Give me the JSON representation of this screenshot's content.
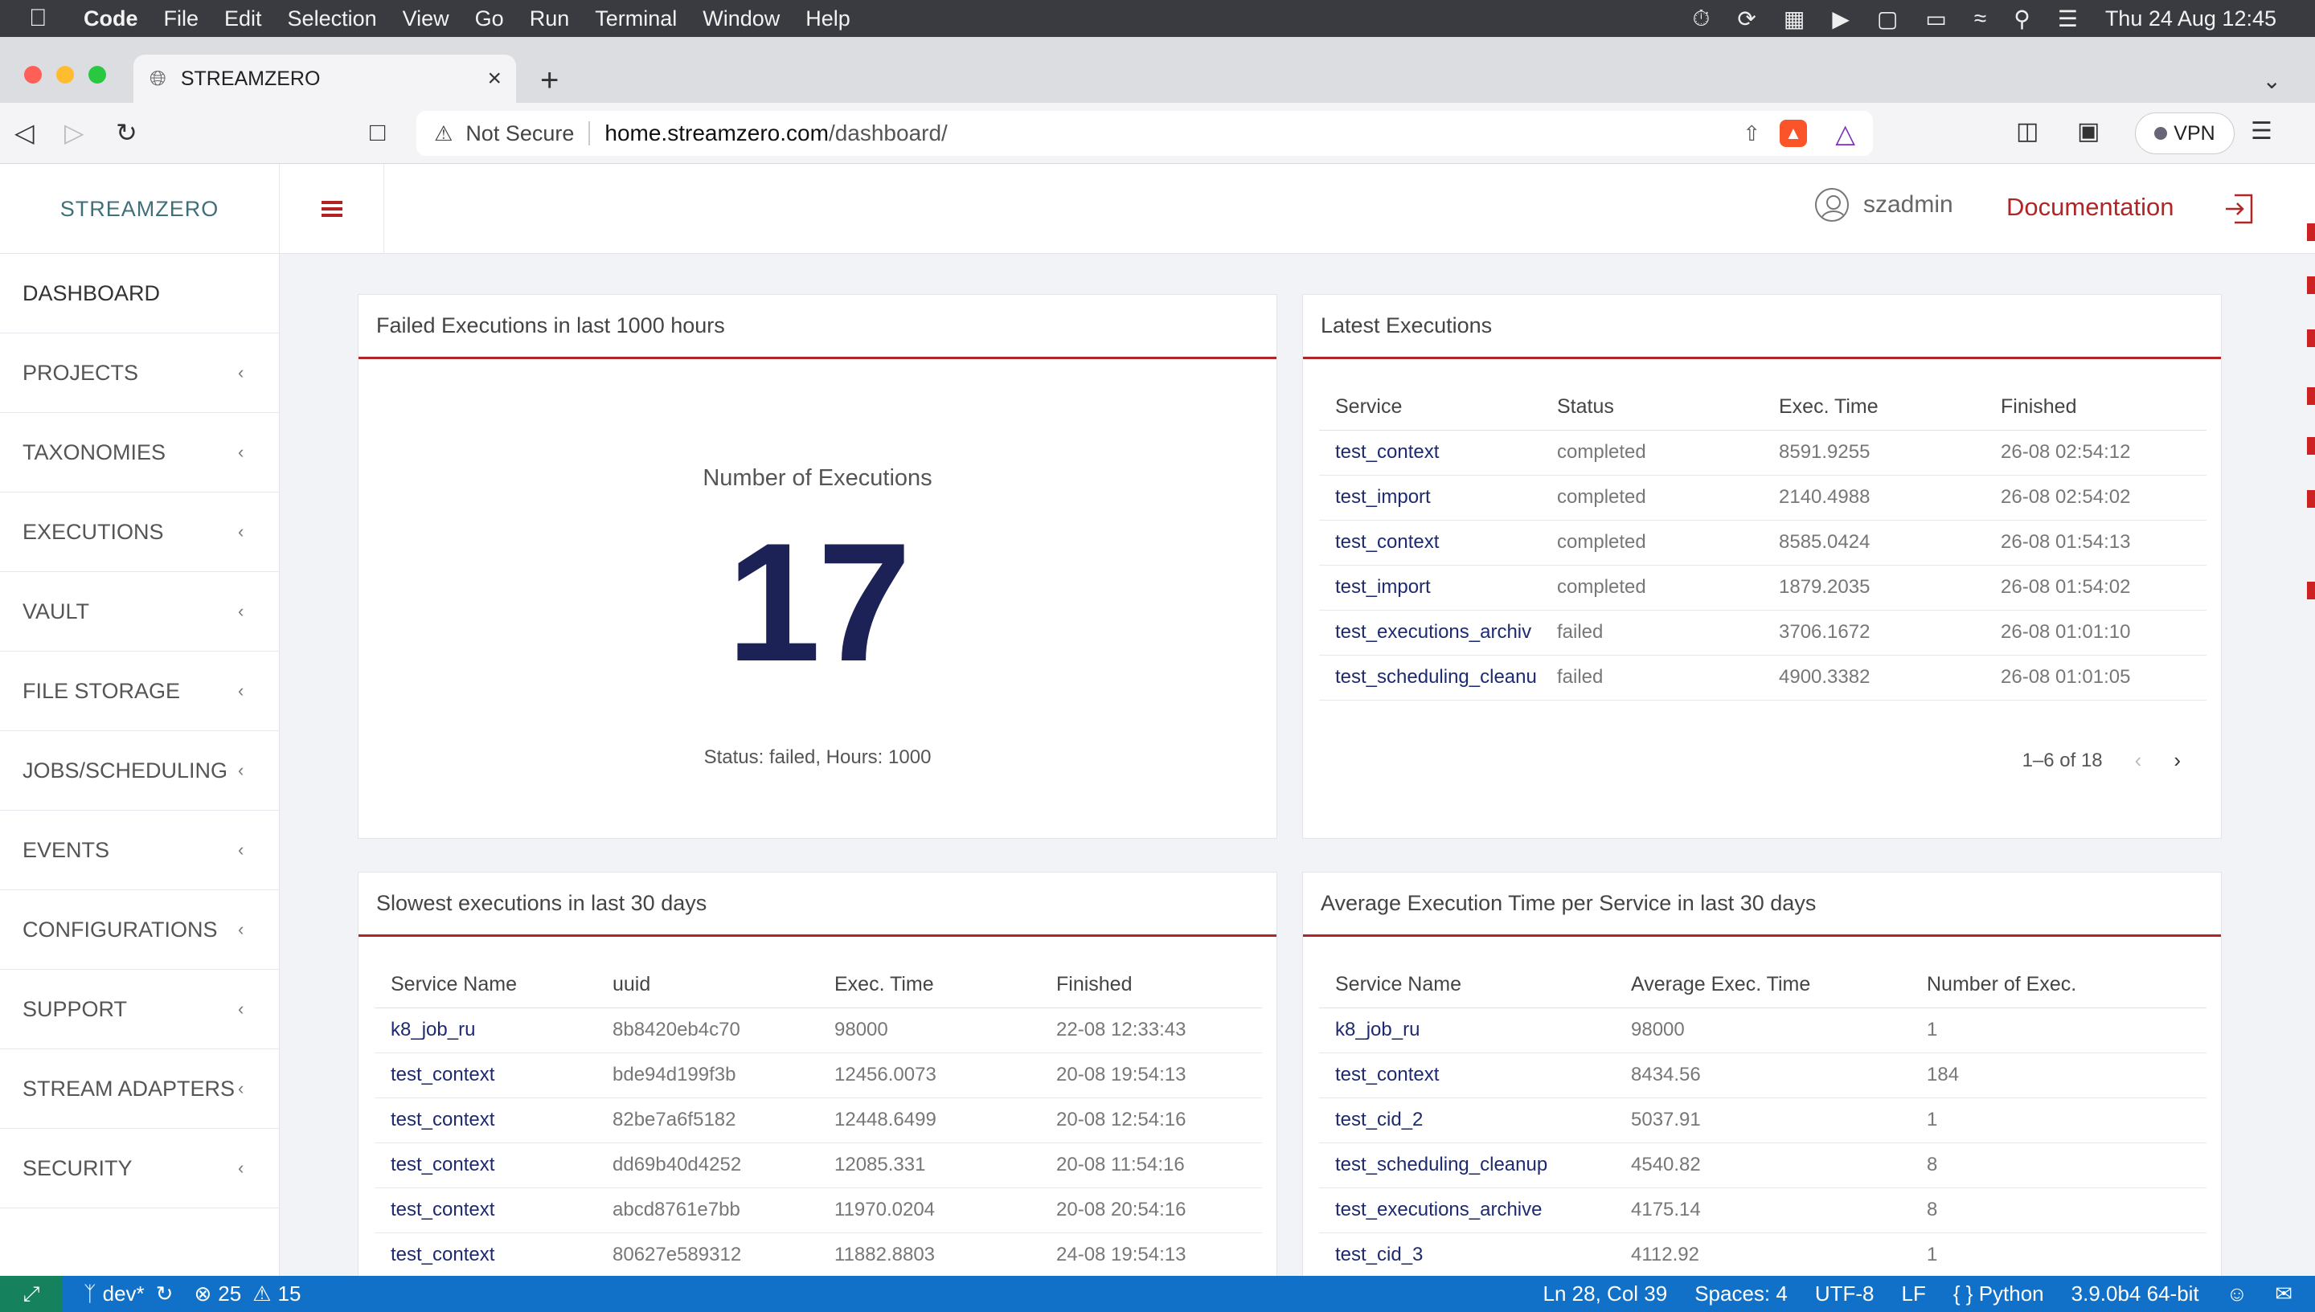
{
  "menubar": {
    "app": "Code",
    "items": [
      "File",
      "Edit",
      "Selection",
      "View",
      "Go",
      "Run",
      "Terminal",
      "Window",
      "Help"
    ],
    "clock": "Thu 24 Aug  12:45"
  },
  "browser": {
    "tab_title": "STREAMZERO",
    "security_label": "Not Secure",
    "url_domain": "home.streamzero.com",
    "url_path": "/dashboard/",
    "vpn_label": "VPN"
  },
  "header": {
    "brand": "STREAMZERO",
    "username": "szadmin",
    "documentation": "Documentation"
  },
  "sidebar": {
    "items": [
      {
        "label": "DASHBOARD",
        "chevron": false
      },
      {
        "label": "PROJECTS",
        "chevron": true
      },
      {
        "label": "TAXONOMIES",
        "chevron": true
      },
      {
        "label": "EXECUTIONS",
        "chevron": true
      },
      {
        "label": "VAULT",
        "chevron": true
      },
      {
        "label": "FILE STORAGE",
        "chevron": true
      },
      {
        "label": "JOBS/SCHEDULING",
        "chevron": true
      },
      {
        "label": "EVENTS",
        "chevron": true
      },
      {
        "label": "CONFIGURATIONS",
        "chevron": true
      },
      {
        "label": "SUPPORT",
        "chevron": true
      },
      {
        "label": "STREAM ADAPTERS",
        "chevron": true
      },
      {
        "label": "SECURITY",
        "chevron": true
      }
    ]
  },
  "failed_card": {
    "title": "Failed Executions in last 1000 hours",
    "metric_label": "Number of Executions",
    "metric_value": "17",
    "subtitle": "Status: failed, Hours: 1000"
  },
  "latest_card": {
    "title": "Latest Executions",
    "columns": [
      "Service",
      "Status",
      "Exec. Time",
      "Finished"
    ],
    "rows": [
      [
        "test_context",
        "completed",
        "8591.9255",
        "26-08 02:54:12"
      ],
      [
        "test_import",
        "completed",
        "2140.4988",
        "26-08 02:54:02"
      ],
      [
        "test_context",
        "completed",
        "8585.0424",
        "26-08 01:54:13"
      ],
      [
        "test_import",
        "completed",
        "1879.2035",
        "26-08 01:54:02"
      ],
      [
        "test_executions_archiv",
        "failed",
        "3706.1672",
        "26-08 01:01:10"
      ],
      [
        "test_scheduling_cleanu",
        "failed",
        "4900.3382",
        "26-08 01:01:05"
      ]
    ],
    "pagination": "1–6 of 18"
  },
  "slowest_card": {
    "title": "Slowest executions in last 30 days",
    "columns": [
      "Service Name",
      "uuid",
      "Exec. Time",
      "Finished"
    ],
    "rows": [
      [
        "k8_job_ru",
        "8b8420eb4c70",
        "98000",
        "22-08 12:33:43"
      ],
      [
        "test_context",
        "bde94d199f3b",
        "12456.0073",
        "20-08 19:54:13"
      ],
      [
        "test_context",
        "82be7a6f5182",
        "12448.6499",
        "20-08 12:54:16"
      ],
      [
        "test_context",
        "dd69b40d4252",
        "12085.331",
        "20-08 11:54:16"
      ],
      [
        "test_context",
        "abcd8761e7bb",
        "11970.0204",
        "20-08 20:54:16"
      ],
      [
        "test_context",
        "80627e589312",
        "11882.8803",
        "24-08 19:54:13"
      ]
    ]
  },
  "average_card": {
    "title": "Average Execution Time per Service in last 30 days",
    "columns": [
      "Service Name",
      "Average Exec. Time",
      "Number of Exec."
    ],
    "rows": [
      [
        "k8_job_ru",
        "98000",
        "1"
      ],
      [
        "test_context",
        "8434.56",
        "184"
      ],
      [
        "test_cid_2",
        "5037.91",
        "1"
      ],
      [
        "test_scheduling_cleanup",
        "4540.82",
        "8"
      ],
      [
        "test_executions_archive",
        "4175.14",
        "8"
      ],
      [
        "test_cid_3",
        "4112.92",
        "1"
      ]
    ]
  },
  "statusbar": {
    "branch": "dev*",
    "errors": "25",
    "warnings": "15",
    "position": "Ln 28, Col 39",
    "spaces": "Spaces: 4",
    "encoding": "UTF-8",
    "eol": "LF",
    "language": "Python",
    "interpreter": "3.9.0b4 64-bit"
  },
  "colors": {
    "accent_red": "#b02626",
    "kpi_navy": "#1c2256",
    "brand_teal": "#3f6f78",
    "statusbar_blue": "#1170c7"
  }
}
